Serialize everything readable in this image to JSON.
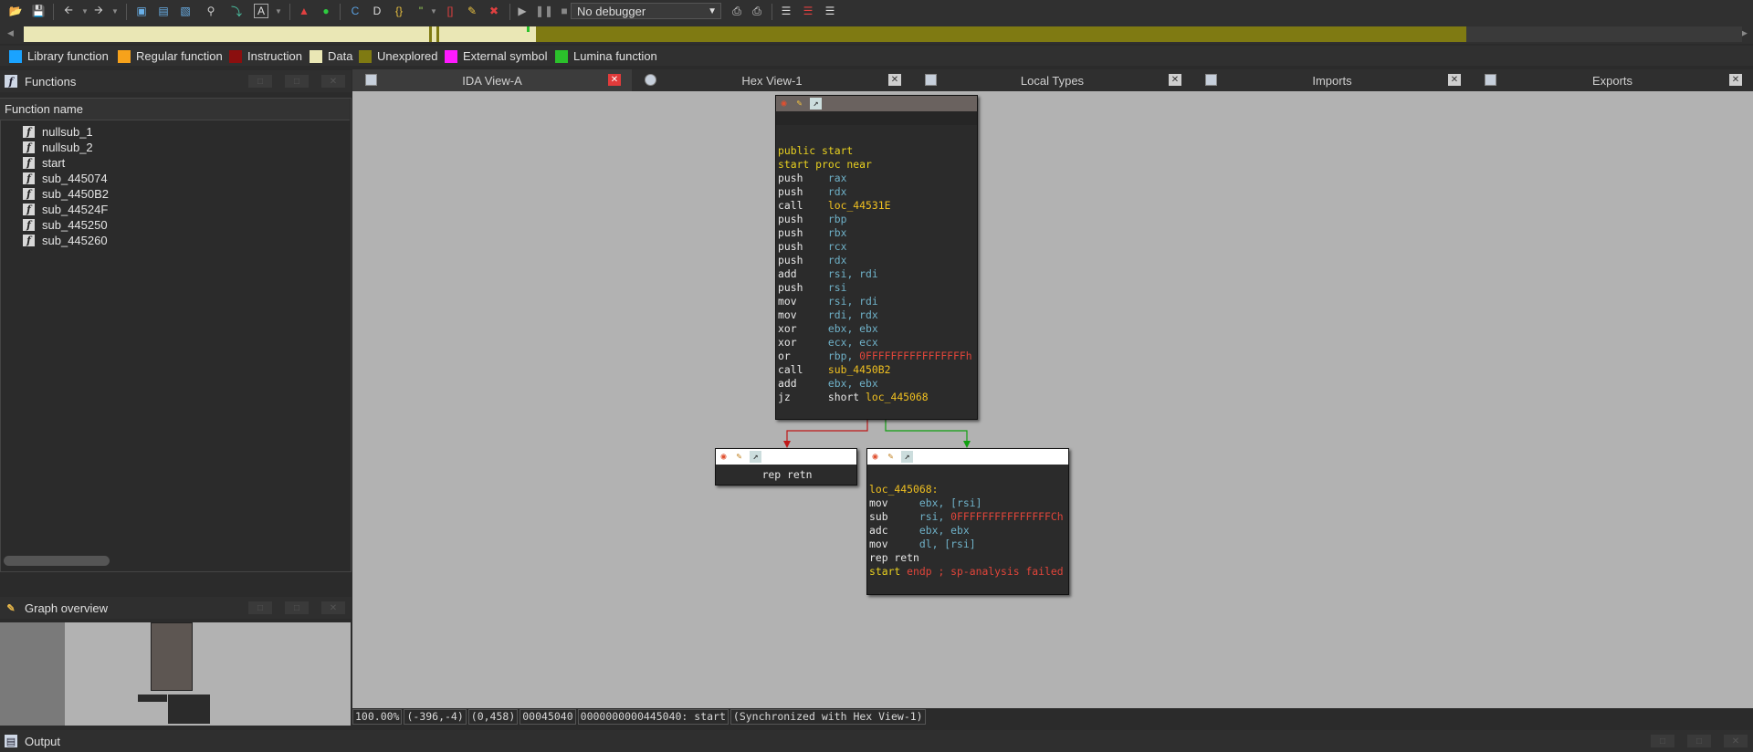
{
  "toolbar": {
    "debugger": "No debugger"
  },
  "legend": [
    {
      "label": "Library function",
      "color": "#1aa3ff"
    },
    {
      "label": "Regular function",
      "color": "#f7a21b"
    },
    {
      "label": "Instruction",
      "color": "#8b0f0f"
    },
    {
      "label": "Data",
      "color": "#eae7b5"
    },
    {
      "label": "Unexplored",
      "color": "#7f7a12"
    },
    {
      "label": "External symbol",
      "color": "#ff1aff"
    },
    {
      "label": "Lumina function",
      "color": "#2bc12b"
    }
  ],
  "functions_panel": {
    "title": "Functions",
    "column": "Function name",
    "items": [
      "nullsub_1",
      "nullsub_2",
      "start",
      "sub_445074",
      "sub_4450B2",
      "sub_44524F",
      "sub_445250",
      "sub_445260"
    ]
  },
  "graph_overview": {
    "title": "Graph overview"
  },
  "output": {
    "title": "Output"
  },
  "tabs": [
    {
      "label": "IDA View-A",
      "active": true
    },
    {
      "label": "Hex View-1",
      "active": false
    },
    {
      "label": "Local Types",
      "active": false
    },
    {
      "label": "Imports",
      "active": false
    },
    {
      "label": "Exports",
      "active": false
    }
  ],
  "blocks": {
    "main": {
      "header": [
        "public start",
        "start proc near"
      ],
      "lines": [
        {
          "m": "push",
          "o": "rax"
        },
        {
          "m": "push",
          "o": "rdx"
        },
        {
          "m": "call",
          "o": "loc_44531E"
        },
        {
          "m": "push",
          "o": "rbp"
        },
        {
          "m": "push",
          "o": "rbx"
        },
        {
          "m": "push",
          "o": "rcx"
        },
        {
          "m": "push",
          "o": "rdx"
        },
        {
          "m": "add",
          "o": "rsi, rdi"
        },
        {
          "m": "push",
          "o": "rsi"
        },
        {
          "m": "mov",
          "o": "rsi, rdi"
        },
        {
          "m": "mov",
          "o": "rdi, rdx"
        },
        {
          "m": "xor",
          "o": "ebx, ebx"
        },
        {
          "m": "xor",
          "o": "ecx, ecx"
        },
        {
          "m": "or",
          "o": "rbp, ",
          "n": "0FFFFFFFFFFFFFFFFh"
        },
        {
          "m": "call",
          "o": "sub_4450B2"
        },
        {
          "m": "add",
          "o": "ebx, ebx"
        },
        {
          "m": "jz",
          "o": "short ",
          "l": "loc_445068"
        }
      ]
    },
    "left": {
      "text": "rep retn"
    },
    "right": {
      "label": "loc_445068:",
      "lines": [
        {
          "m": "mov",
          "o": "ebx, [rsi]"
        },
        {
          "m": "sub",
          "o": "rsi, ",
          "n": "0FFFFFFFFFFFFFFFCh"
        },
        {
          "m": "adc",
          "o": "ebx, ebx"
        },
        {
          "m": "mov",
          "o": "dl, [rsi]"
        }
      ],
      "retn": "rep retn",
      "end_label": "start",
      "end_text": "endp ; sp-analysis failed"
    }
  },
  "status": [
    "100.00%",
    "(-396,-4)",
    "(0,458)",
    "00045040",
    "0000000000445040: start",
    "(Synchronized with Hex View-1)"
  ]
}
